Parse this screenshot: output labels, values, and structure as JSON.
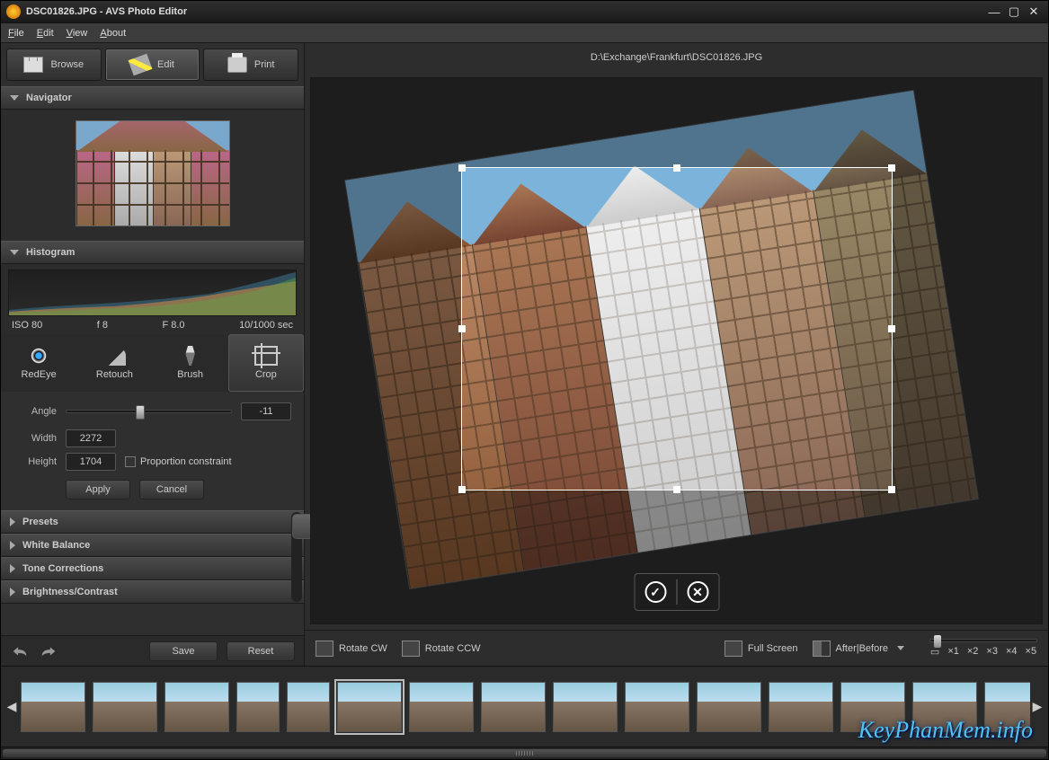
{
  "title": "DSC01826.JPG  -  AVS Photo Editor",
  "menu": {
    "file": "File",
    "edit": "Edit",
    "view": "View",
    "about": "About"
  },
  "modes": {
    "browse": "Browse",
    "edit": "Edit",
    "print": "Print"
  },
  "panels": {
    "navigator": "Navigator",
    "histogram": "Histogram",
    "presets": "Presets",
    "whiteBalance": "White Balance",
    "toneCorrections": "Tone Corrections",
    "brightnessContrast": "Brightness/Contrast"
  },
  "histo": {
    "iso": "ISO 80",
    "fstop1": "f 8",
    "fstop2": "F 8.0",
    "shutter": "10/1000 sec"
  },
  "tools": {
    "redeye": "RedEye",
    "retouch": "Retouch",
    "brush": "Brush",
    "crop": "Crop"
  },
  "crop": {
    "angleLabel": "Angle",
    "angleValue": "-11",
    "widthLabel": "Width",
    "widthValue": "2272",
    "heightLabel": "Height",
    "heightValue": "1704",
    "proportion": "Proportion constraint",
    "apply": "Apply",
    "cancel": "Cancel"
  },
  "sideBottom": {
    "save": "Save",
    "reset": "Reset"
  },
  "path": "D:\\Exchange\\Frankfurt\\DSC01826.JPG",
  "toolbar2": {
    "rotateCW": "Rotate CW",
    "rotateCCW": "Rotate CCW",
    "fullscreen": "Full Screen",
    "afterBefore": "After|Before"
  },
  "zoom": {
    "fit": "▭",
    "x1": "×1",
    "x2": "×2",
    "x3": "×3",
    "x4": "×4",
    "x5": "×5"
  },
  "thumbs": [
    {
      "id": "t1"
    },
    {
      "id": "t2"
    },
    {
      "id": "t3"
    },
    {
      "id": "t4",
      "portrait": true
    },
    {
      "id": "t5",
      "portrait": true
    },
    {
      "id": "t6",
      "selected": true
    },
    {
      "id": "t7"
    },
    {
      "id": "t8"
    },
    {
      "id": "t9"
    },
    {
      "id": "t10"
    },
    {
      "id": "t11"
    },
    {
      "id": "t12"
    },
    {
      "id": "t13"
    },
    {
      "id": "t14"
    },
    {
      "id": "t15"
    }
  ],
  "watermark": "KeyPhanMem.info"
}
